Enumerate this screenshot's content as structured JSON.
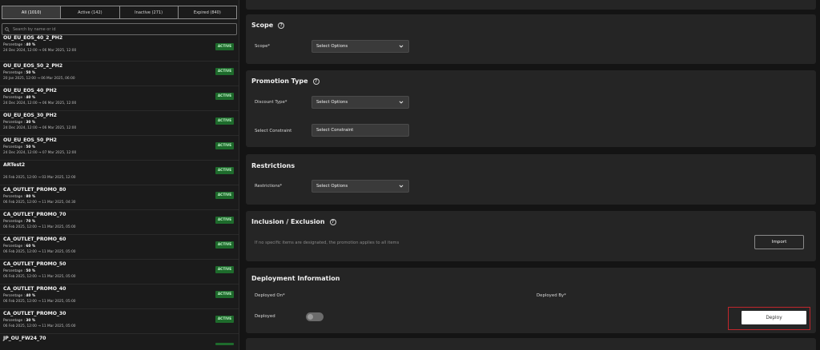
{
  "filters": {
    "tabs": [
      "All (1010)",
      "Active (142)",
      "Inactive (271)",
      "Expired (840)"
    ],
    "active_tab": 0,
    "search_placeholder": "Search by name or id"
  },
  "promotions": [
    {
      "name": "OU_EU_EOS_40_2_PH2",
      "percentage_label": "Percentage :",
      "percentage": "40 %",
      "dates": "24 Dec 2024, 12:00 → 06 Mar 2025, 12:00",
      "status": "ACTIVE"
    },
    {
      "name": "OU_EU_EOS_50_2_PH2",
      "percentage_label": "Percentage :",
      "percentage": "50 %",
      "dates": "20 Jan 2025, 12:00 → 06 Mar 2025, 06:00",
      "status": "ACTIVE"
    },
    {
      "name": "OU_EU_EOS_40_PH2",
      "percentage_label": "Percentage :",
      "percentage": "40 %",
      "dates": "24 Dec 2024, 12:00 → 06 Mar 2025, 12:00",
      "status": "ACTIVE"
    },
    {
      "name": "OU_EU_EOS_30_PH2",
      "percentage_label": "Percentage :",
      "percentage": "30 %",
      "dates": "24 Dec 2024, 12:00 → 06 Mar 2025, 12:00",
      "status": "ACTIVE"
    },
    {
      "name": "OU_EU_EOS_50_PH2",
      "percentage_label": "Percentage :",
      "percentage": "50 %",
      "dates": "24 Dec 2024, 12:00 → 07 Mar 2025, 12:00",
      "status": "ACTIVE"
    },
    {
      "name": "ARTest2",
      "percentage_label": "",
      "percentage": "",
      "dates": "26 Feb 2025, 12:00 → 03 Mar 2025, 12:00",
      "status": "ACTIVE"
    },
    {
      "name": "CA_OUTLET_PROMO_80",
      "percentage_label": "Percentage :",
      "percentage": "80 %",
      "dates": "06 Feb 2025, 12:00 → 11 Mar 2025, 04:30",
      "status": "ACTIVE"
    },
    {
      "name": "CA_OUTLET_PROMO_70",
      "percentage_label": "Percentage :",
      "percentage": "70 %",
      "dates": "06 Feb 2025, 12:00 → 11 Mar 2025, 05:00",
      "status": "ACTIVE"
    },
    {
      "name": "CA_OUTLET_PROMO_60",
      "percentage_label": "Percentage :",
      "percentage": "60 %",
      "dates": "06 Feb 2025, 12:00 → 11 Mar 2025, 05:00",
      "status": "ACTIVE"
    },
    {
      "name": "CA_OUTLET_PROMO_50",
      "percentage_label": "Percentage :",
      "percentage": "50 %",
      "dates": "06 Feb 2025, 12:00 → 11 Mar 2025, 05:00",
      "status": "ACTIVE"
    },
    {
      "name": "CA_OUTLET_PROMO_40",
      "percentage_label": "Percentage :",
      "percentage": "40 %",
      "dates": "06 Feb 2025, 12:00 → 11 Mar 2025, 05:00",
      "status": "ACTIVE"
    },
    {
      "name": "CA_OUTLET_PROMO_30",
      "percentage_label": "Percentage :",
      "percentage": "30 %",
      "dates": "06 Feb 2025, 12:00 → 11 Mar 2025, 05:00",
      "status": "ACTIVE"
    },
    {
      "name": "JP_OU_FW24_70",
      "percentage_label": "",
      "percentage": "",
      "dates": "",
      "status": ""
    }
  ],
  "scope": {
    "title": "Scope",
    "field_label": "Scope*",
    "select_value": "Select Options"
  },
  "promotion_type": {
    "title": "Promotion Type",
    "discount_label": "Discount Type*",
    "discount_value": "Select Options",
    "constraint_label": "Select Constraint",
    "constraint_value": "Select Constraint"
  },
  "restrictions": {
    "title": "Restrictions",
    "field_label": "Restrictions*",
    "select_value": "Select Options"
  },
  "inclusion": {
    "title": "Inclusion / Exclusion",
    "hint": "If no specific items are designated, the promotion applies to all items",
    "import_label": "Import"
  },
  "deployment": {
    "title": "Deployment Information",
    "deployed_on_label": "Deployed On*",
    "deployed_by_label": "Deployed By*",
    "deployed_label": "Deployed",
    "deploy_button": "Deploy",
    "deployed_toggle": false
  },
  "colors": {
    "active_badge_bg": "#1e6b2c",
    "active_badge_text": "#bff3c7",
    "highlight_frame": "#c0262c"
  }
}
